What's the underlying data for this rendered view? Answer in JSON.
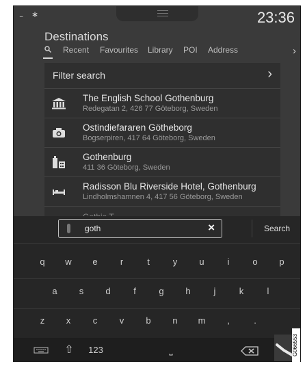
{
  "status": {
    "signal": "...",
    "bluetooth": "∗",
    "time": "23:36"
  },
  "page": {
    "title": "Destinations"
  },
  "tabs": [
    {
      "label": "Recent"
    },
    {
      "label": "Favourites"
    },
    {
      "label": "Library"
    },
    {
      "label": "POI"
    },
    {
      "label": "Address"
    }
  ],
  "list": {
    "filter_label": "Filter search",
    "items": [
      {
        "name": "The English School Gothenburg",
        "address": "Redegatan 2, 426 77 Göteborg, Sweden",
        "icon": "school-icon"
      },
      {
        "name": "Ostindiefararen Götheborg",
        "address": "Bogserpiren, 417 64 Göteborg, Sweden",
        "icon": "camera-icon"
      },
      {
        "name": "Gothenburg",
        "address": "411 36 Göteborg, Sweden",
        "icon": "city-icon"
      },
      {
        "name": "Radisson Blu Riverside Hotel, Gothenburg",
        "address": "Lindholmshamnen 4, 417 56 Göteborg, Sweden",
        "icon": "hotel-icon"
      }
    ],
    "partial_next": "Gothia T..."
  },
  "search": {
    "value": "goth",
    "search_label": "Search"
  },
  "keyboard": {
    "row1": [
      "q",
      "w",
      "e",
      "r",
      "t",
      "y",
      "u",
      "i",
      "o",
      "p"
    ],
    "row2": [
      "a",
      "s",
      "d",
      "f",
      "g",
      "h",
      "j",
      "k",
      "l"
    ],
    "row3": [
      "z",
      "x",
      "c",
      "v",
      "b",
      "n",
      "m",
      ",",
      "."
    ],
    "numbers_label": "123",
    "space_label": "⎵"
  },
  "figure_code": "G066553"
}
